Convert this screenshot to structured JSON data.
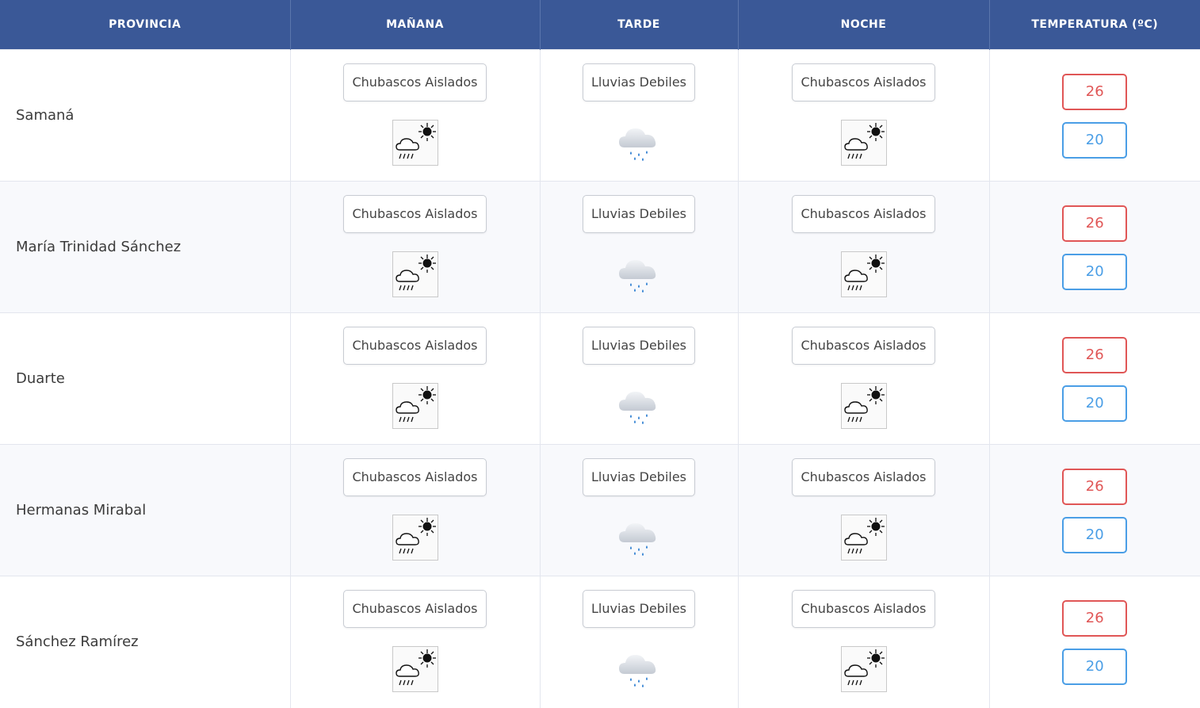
{
  "headers": {
    "provincia": "PROVINCIA",
    "manana": "MAÑANA",
    "tarde": "TARDE",
    "noche": "NOCHE",
    "temperatura": "TEMPERATURA (ºC)"
  },
  "colors": {
    "header_bg": "#3a5897",
    "max_temp": "#e05656",
    "min_temp": "#4a9ee6"
  },
  "rows": [
    {
      "provincia": "Samaná",
      "manana": {
        "label": "Chubascos Aislados",
        "icon": "sun-cloud-rain-icon"
      },
      "tarde": {
        "label": "Lluvias Debiles",
        "icon": "rain-cloud-icon"
      },
      "noche": {
        "label": "Chubascos Aislados",
        "icon": "sun-cloud-rain-icon"
      },
      "max": "26",
      "min": "20"
    },
    {
      "provincia": "María Trinidad Sánchez",
      "manana": {
        "label": "Chubascos Aislados",
        "icon": "sun-cloud-rain-icon"
      },
      "tarde": {
        "label": "Lluvias Debiles",
        "icon": "rain-cloud-icon"
      },
      "noche": {
        "label": "Chubascos Aislados",
        "icon": "sun-cloud-rain-icon"
      },
      "max": "26",
      "min": "20"
    },
    {
      "provincia": "Duarte",
      "manana": {
        "label": "Chubascos Aislados",
        "icon": "sun-cloud-rain-icon"
      },
      "tarde": {
        "label": "Lluvias Debiles",
        "icon": "rain-cloud-icon"
      },
      "noche": {
        "label": "Chubascos Aislados",
        "icon": "sun-cloud-rain-icon"
      },
      "max": "26",
      "min": "20"
    },
    {
      "provincia": "Hermanas Mirabal",
      "manana": {
        "label": "Chubascos Aislados",
        "icon": "sun-cloud-rain-icon"
      },
      "tarde": {
        "label": "Lluvias Debiles",
        "icon": "rain-cloud-icon"
      },
      "noche": {
        "label": "Chubascos Aislados",
        "icon": "sun-cloud-rain-icon"
      },
      "max": "26",
      "min": "20"
    },
    {
      "provincia": "Sánchez Ramírez",
      "manana": {
        "label": "Chubascos Aislados",
        "icon": "sun-cloud-rain-icon"
      },
      "tarde": {
        "label": "Lluvias Debiles",
        "icon": "rain-cloud-icon"
      },
      "noche": {
        "label": "Chubascos Aislados",
        "icon": "sun-cloud-rain-icon"
      },
      "max": "26",
      "min": "20"
    }
  ]
}
